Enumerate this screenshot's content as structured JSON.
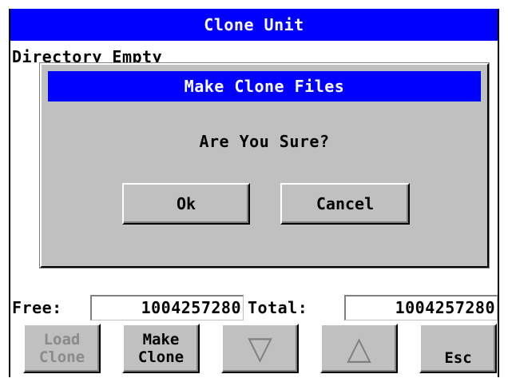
{
  "window": {
    "title": "Clone Unit"
  },
  "directory": {
    "status": "Directory Empty"
  },
  "dialog": {
    "title": "Make Clone Files",
    "message": "Are You Sure?",
    "ok_label": "Ok",
    "cancel_label": "Cancel"
  },
  "storage": {
    "free_label": "Free:",
    "free_value": "1004257280",
    "total_label": "Total:",
    "total_value": "1004257280"
  },
  "softkeys": {
    "load_clone": "Load\nClone",
    "make_clone": "Make\nClone",
    "down_icon": "down-triangle-icon",
    "up_icon": "up-triangle-icon",
    "esc": "Esc"
  },
  "colors": {
    "title_bar": "#0000ff",
    "panel": "#c0c0c0",
    "disabled_text": "#8a8a8a"
  }
}
